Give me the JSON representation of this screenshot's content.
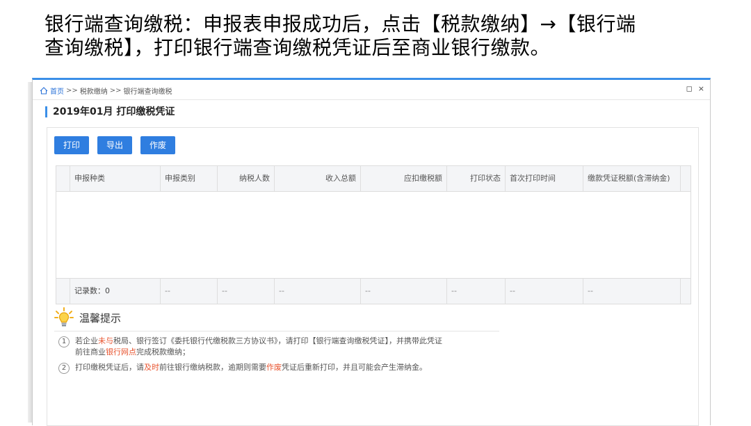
{
  "heading": {
    "line1": "银行端查询缴税：申报表申报成功后，点击【税款缴纳】→【银行端",
    "line2": "查询缴税】，打印银行端查询缴税凭证后至商业银行缴款。"
  },
  "breadcrumb": {
    "home": "首页",
    "sep1": ">>",
    "level1": "税款缴纳",
    "sep2": ">>",
    "level2": "银行端查询缴税"
  },
  "window_controls": {
    "restore": "◻",
    "close": "×"
  },
  "page_title": "2019年01月  打印缴税凭证",
  "toolbar": {
    "print": "打印",
    "export": "导出",
    "void": "作废"
  },
  "table": {
    "columns": [
      "申报种类",
      "申报类别",
      "纳税人数",
      "收入总额",
      "应扣缴税额",
      "打印状态",
      "首次打印时间",
      "缴款凭证税额(含滞纳金)"
    ],
    "footer": {
      "record_count": "记录数：0",
      "cells": [
        "--",
        "--",
        "--",
        "--",
        "--",
        "--",
        "--"
      ]
    }
  },
  "tips": {
    "title": "温馨提示",
    "items": [
      {
        "num": "1",
        "p1": "若企业",
        "r1": "未与",
        "p2": "税局、银行签订《委托银行代缴税款三方协议书》，请打印【银行端查询缴税凭证】，并携带此凭证",
        "p3": "前往商业",
        "r2": "银行网点",
        "p4": "完成税款缴纳；"
      },
      {
        "num": "2",
        "p1": "打印缴税凭证后，请",
        "r1": "及时",
        "p2": "前往银行缴纳税款，逾期则需要",
        "r2": "作废",
        "p3": "凭证后重新打印，并且可能会产生滞纳金。"
      }
    ]
  },
  "colors": {
    "accent": "#2f7ee0",
    "highlight": "#e8542f",
    "window_border": "#3b8fe8"
  }
}
